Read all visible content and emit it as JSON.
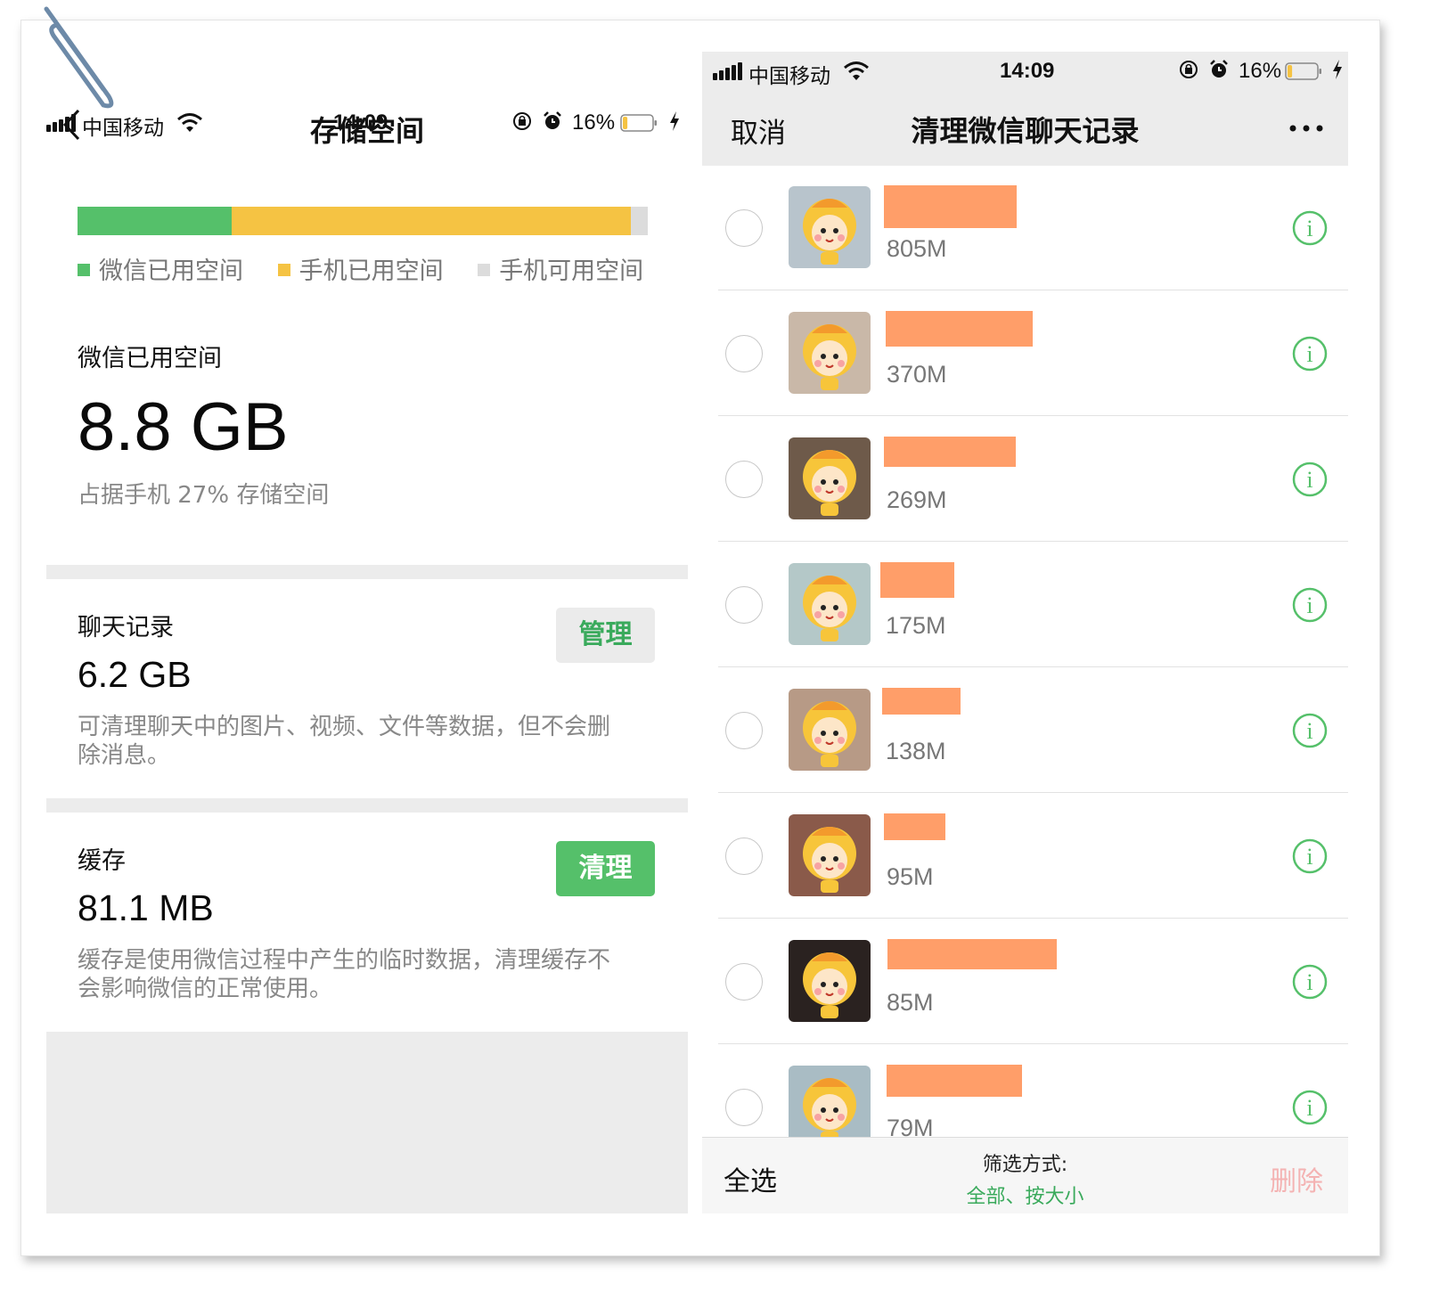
{
  "left": {
    "status": {
      "carrier": "中国移动",
      "time": "14:09",
      "battery_pct": "16%",
      "battery_level": 0.16
    },
    "title": "存储空间",
    "storage_bar": {
      "segments": [
        {
          "name": "wechat",
          "fraction": 0.27,
          "color": "#55c06a"
        },
        {
          "name": "phone_used",
          "fraction": 0.7,
          "color": "#f5c343"
        },
        {
          "name": "phone_free",
          "fraction": 0.03,
          "color": "#dcdcdc"
        }
      ]
    },
    "legend": [
      {
        "label": "微信已用空间",
        "color": "#55c06a"
      },
      {
        "label": "手机已用空间",
        "color": "#f5c343"
      },
      {
        "label": "手机可用空间",
        "color": "#dcdcdc"
      }
    ],
    "wechat_used": {
      "label": "微信已用空间",
      "value": "8.8 GB",
      "note": "占据手机 27% 存储空间"
    },
    "chat_records": {
      "label": "聊天记录",
      "value": "6.2 GB",
      "button": "管理",
      "desc": "可清理聊天中的图片、视频、文件等数据，但不会删除消息。"
    },
    "cache": {
      "label": "缓存",
      "value": "81.1 MB",
      "button": "清理",
      "desc": "缓存是使用微信过程中产生的临时数据，清理缓存不会影响微信的正常使用。"
    }
  },
  "right": {
    "status": {
      "carrier": "中国移动",
      "time": "14:09",
      "battery_pct": "16%",
      "battery_level": 0.16
    },
    "cancel": "取消",
    "title": "清理微信聊天记录",
    "more_icon": "ellipsis-icon",
    "chats": [
      {
        "size": "805M"
      },
      {
        "size": "370M"
      },
      {
        "size": "269M"
      },
      {
        "size": "175M"
      },
      {
        "size": "138M"
      },
      {
        "size": "95M"
      },
      {
        "size": "85M"
      },
      {
        "size": "79M"
      }
    ],
    "footer": {
      "select_all": "全选",
      "filter_label": "筛选方式:",
      "filter_value": "全部、按大小",
      "delete": "删除"
    }
  },
  "colors": {
    "accent": "#3aaa5c",
    "redaction": "#ff9e69",
    "info_icon": "#55c06a"
  }
}
